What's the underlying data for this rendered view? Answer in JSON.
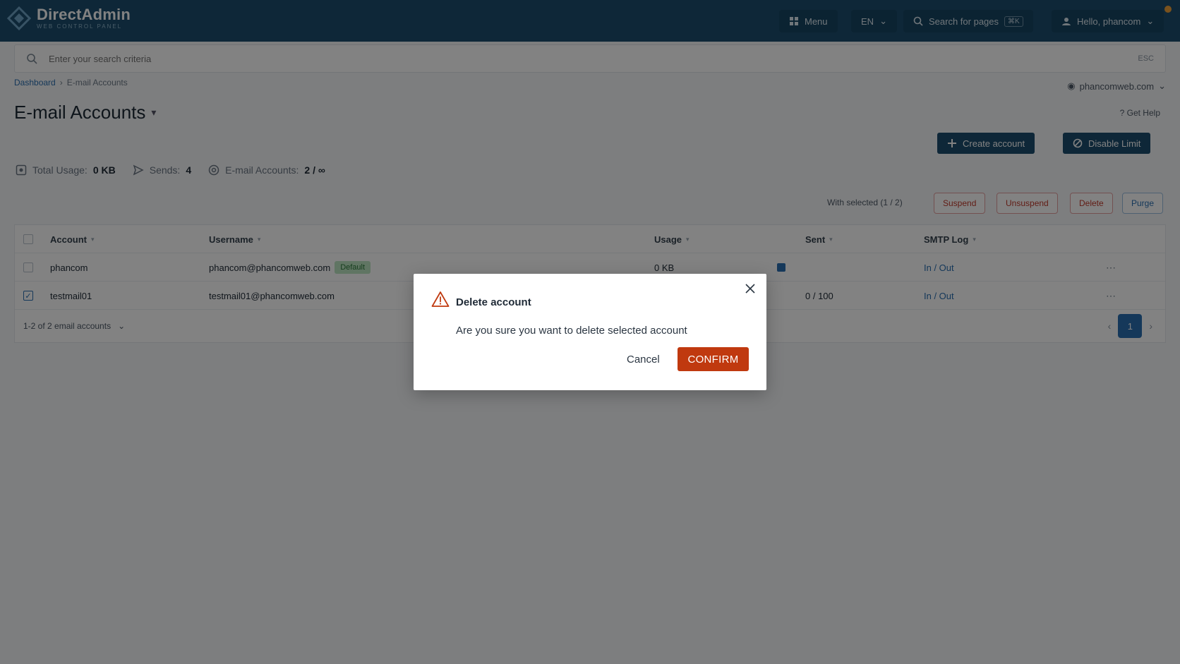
{
  "app": {
    "name": "DirectAdmin",
    "tagline": "WEB CONTROL PANEL"
  },
  "topbar": {
    "menu_label": "Menu",
    "lang_label": "EN",
    "search_pages_label": "Search for pages",
    "search_shortcut": "⌘K",
    "user_label": "Hello, phancom"
  },
  "search": {
    "placeholder": "Enter your search criteria",
    "shortcut": "ESC"
  },
  "breadcrumb": {
    "home": "Dashboard",
    "current": "E-mail Accounts"
  },
  "domain_selector": {
    "value": "phancomweb.com"
  },
  "page": {
    "title": "E-mail Accounts",
    "help_label": "?  Get Help"
  },
  "actions": {
    "create_account": "Create account",
    "disable_limit": "Disable Limit"
  },
  "stats": {
    "usage_label": "Total Usage:",
    "usage_value": "0 KB",
    "sends_label": "Sends:",
    "sends_value": "4",
    "accounts_label": "E-mail Accounts:",
    "accounts_value": "2 / ∞"
  },
  "bulk": {
    "label": "With selected (1 / 2)",
    "suspend": "Suspend",
    "unsuspend": "Unsuspend",
    "delete": "Delete",
    "purge": "Purge"
  },
  "table": {
    "columns": {
      "account": "Account",
      "username": "Username",
      "usage": "Usage",
      "sent": "Sent",
      "smtp_log": "SMTP Log"
    },
    "rows": [
      {
        "account": "phancom",
        "username": "phancom@phancomweb.com",
        "badge": "Default",
        "usage": "0 KB",
        "sent": "",
        "smtp_log": "In / Out",
        "checked": false
      },
      {
        "account": "testmail01",
        "username": "testmail01@phancomweb.com",
        "badge": "",
        "usage": "",
        "sent": "0 / 100",
        "smtp_log": "In / Out",
        "checked": true
      }
    ],
    "footer": {
      "info": "1-2 of 2 email accounts",
      "page": "1"
    }
  },
  "modal": {
    "title": "Delete account",
    "message": "Are you sure you want to delete selected account",
    "cancel_label": "Cancel",
    "confirm_label": "CONFIRM"
  },
  "colors": {
    "primary": "#1d4e6e",
    "confirm": "#c0390f",
    "warning_icon": "#c0390f",
    "overlay": "rgba(0,0,0,0.49)"
  }
}
